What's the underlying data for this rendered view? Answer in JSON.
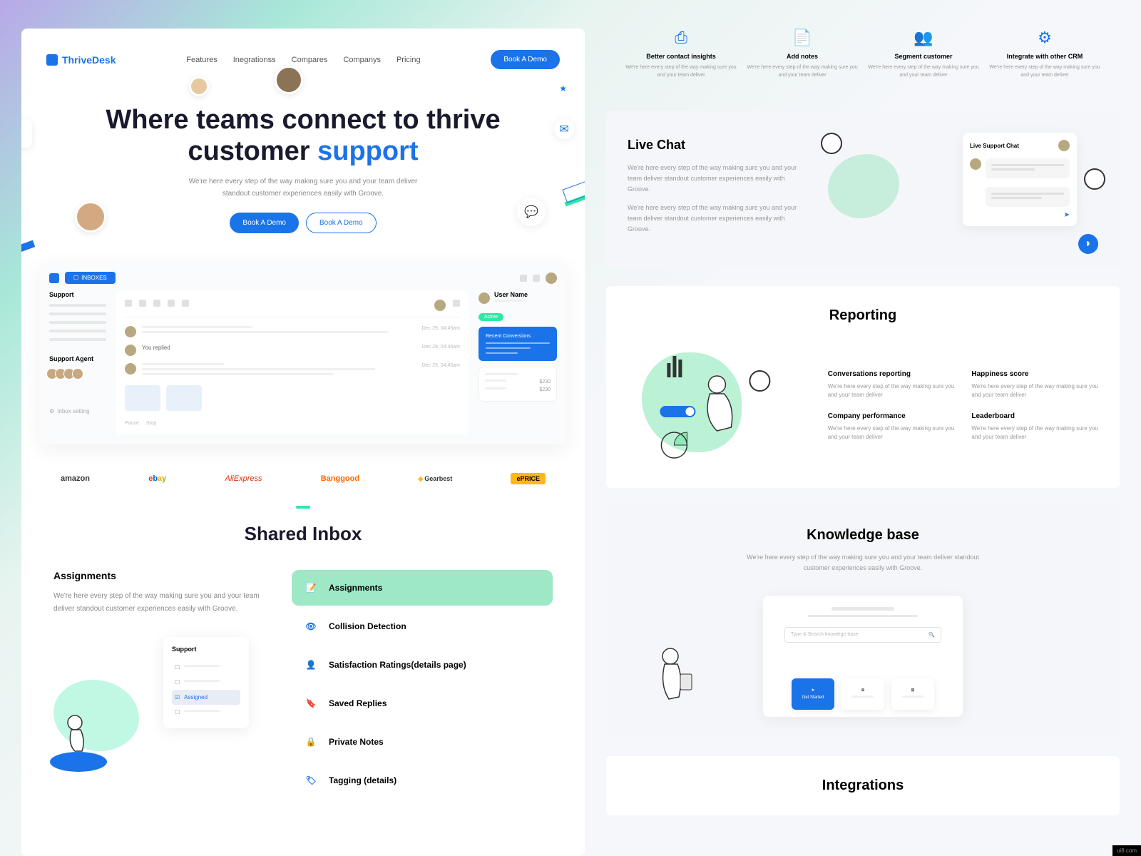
{
  "brand": "ThriveDesk",
  "nav": [
    "Features",
    "Inegrationss",
    "Compares",
    "Companys",
    "Pricing"
  ],
  "cta": "Book A Demo",
  "hero": {
    "title_a": "Where teams connect to thrive customer ",
    "title_b": "support",
    "subtitle": "We're here every step of the way making sure you and your team deliver standout customer experiences easily with Groove.",
    "btn1": "Book A Demo",
    "btn2": "Book A Demo"
  },
  "dash": {
    "tab": "INBOXES",
    "side_title": "Support",
    "agents_title": "Support Agent",
    "settings": "Inbox setting",
    "user": "User Name",
    "badge": "Active",
    "card_title": "Recent Conversions",
    "replied": "You replied",
    "date1": "Dec 29, 04:45am",
    "date2": "Dec 29, 04:45am",
    "date3": "Dec 29, 04:45am",
    "info1": "$230",
    "info2": "$230",
    "footer1": "Pause",
    "footer2": "Stop"
  },
  "logos": {
    "amazon": "amazon",
    "ebay_e": "e",
    "ebay_b": "b",
    "ebay_a": "a",
    "ebay_y": "y",
    "aliexpress": "AliExpress",
    "banggood_a": "Bang",
    "banggood_b": "good",
    "gearbest": "Gearbest",
    "eprice": "ePRICE"
  },
  "shared_inbox": {
    "title": "Shared Inbox",
    "heading": "Assignments",
    "desc": "We're here every step of the way making sure you and your team deliver standout customer experiences easily with Groove.",
    "card_title": "Support",
    "card_item": "Assigned",
    "features": [
      "Assignments",
      "Collision Detection",
      "Satisfaction Ratings(details page)",
      "Saved Replies",
      "Private Notes",
      "Tagging (details)"
    ]
  },
  "top_features": [
    {
      "title": "Better contact insights",
      "desc": "We're here every step of the way making sure you and your team deliver"
    },
    {
      "title": "Add notes",
      "desc": "We're here every step of the way making sure you and your team deliver"
    },
    {
      "title": "Segment customer",
      "desc": "We're here every step of the way making sure you and your team deliver"
    },
    {
      "title": "Integrate with other CRM",
      "desc": "We're here every step of the way making sure you and your team deliver"
    }
  ],
  "livechat": {
    "title": "Live Chat",
    "p1": "We're here every step of the way making sure you and your team deliver standout customer experiences easily with Groove.",
    "p2": "We're here every step of the way making sure you and your team deliver standout customer experiences easily with Groove.",
    "card_title": "Live Support Chat"
  },
  "reporting": {
    "title": "Reporting",
    "items": [
      {
        "title": "Conversations reporting",
        "desc": "We're here every step of the way making sure you and your team deliver"
      },
      {
        "title": "Happiness score",
        "desc": "We're here every step of the way making sure you and your team deliver"
      },
      {
        "title": "Company performance",
        "desc": "We're here every step of the way making sure you and your team deliver"
      },
      {
        "title": "Leaderboard",
        "desc": "We're here every step of the way making sure you and your team deliver"
      }
    ]
  },
  "kb": {
    "title": "Knowledge base",
    "desc": "We're here every step of the way making sure you and your team deliver standout customer experiences easily with Groove.",
    "search": "Type & Search knowlege base",
    "btn": "Get Started"
  },
  "integrations": {
    "title": "Integrations"
  },
  "watermark": "ui8.com"
}
